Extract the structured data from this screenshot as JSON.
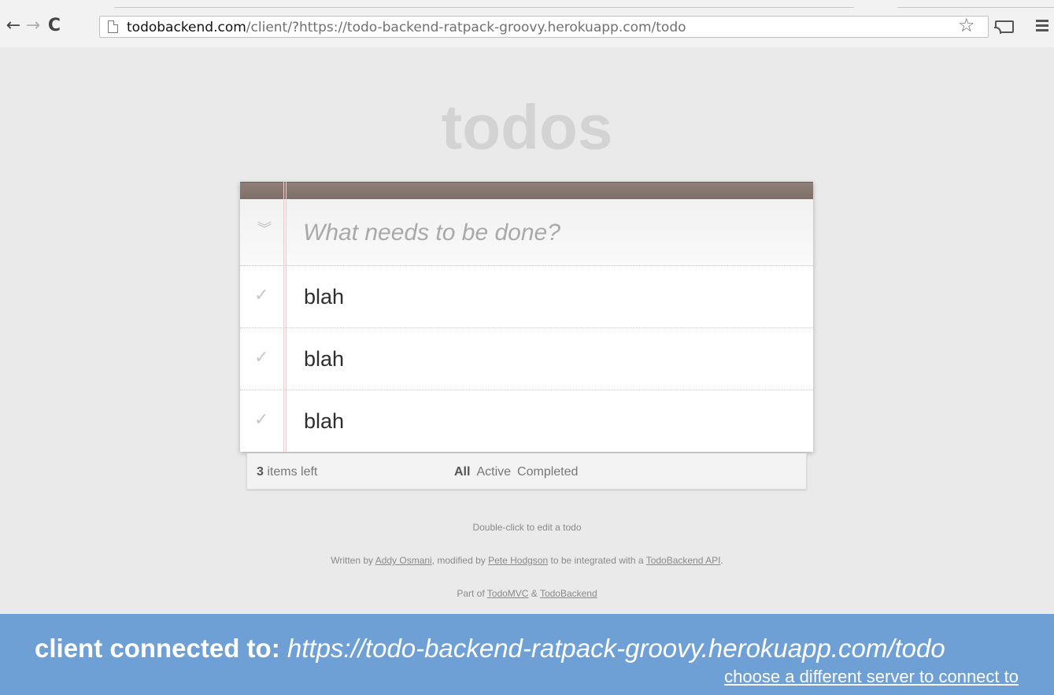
{
  "browser": {
    "url_host": "todobackend.com",
    "url_rest": "/client/?https://todo-backend-ratpack-groovy.herokuapp.com/todo",
    "back_icon": "←",
    "forward_icon": "→",
    "reload_icon": "C",
    "star_icon": "☆"
  },
  "app": {
    "title": "todos",
    "new_todo_placeholder": "What needs to be done?",
    "toggle_all_icon": "»",
    "todos": [
      {
        "label": "blah",
        "completed": false,
        "check_icon": "✓"
      },
      {
        "label": "blah",
        "completed": false,
        "check_icon": "✓"
      },
      {
        "label": "blah",
        "completed": false,
        "check_icon": "✓"
      }
    ],
    "footer": {
      "count": "3",
      "count_suffix": " items left",
      "filters": [
        "All",
        "Active",
        "Completed"
      ],
      "selected_filter": "All"
    }
  },
  "info": {
    "hint": "Double-click to edit a todo",
    "written_by_prefix": "Written by ",
    "author": "Addy Osmani",
    "modified_by_text": ", modified by ",
    "modifier": "Pete Hodgson",
    "integrated_text": " to be integrated with a ",
    "api_link": "TodoBackend API",
    "period": ".",
    "part_of_prefix": "Part of ",
    "todomvc_link": "TodoMVC",
    "amp": " & ",
    "todobackend_link": "TodoBackend"
  },
  "banner": {
    "label": "client connected to:",
    "server_url": "https://todo-backend-ratpack-groovy.herokuapp.com/todo",
    "change_link": "choose a different server to connect to",
    "color": "#6e9fd5"
  }
}
